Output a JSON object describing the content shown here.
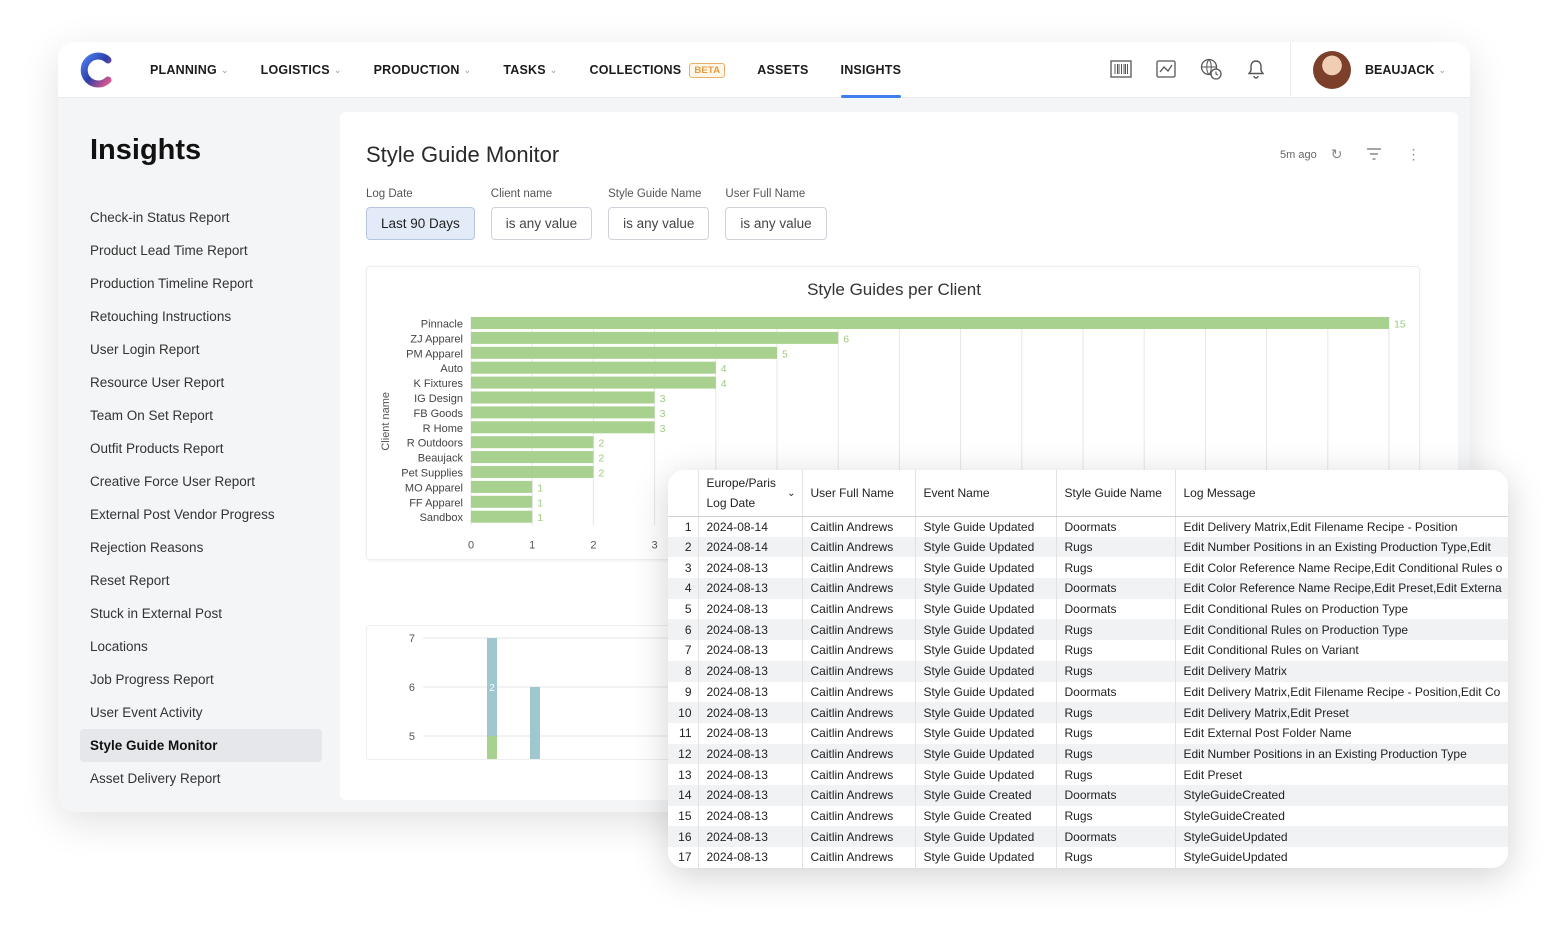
{
  "nav": {
    "items": [
      {
        "label": "PLANNING",
        "chevron": true
      },
      {
        "label": "LOGISTICS",
        "chevron": true
      },
      {
        "label": "PRODUCTION",
        "chevron": true
      },
      {
        "label": "TASKS",
        "chevron": true
      },
      {
        "label": "COLLECTIONS",
        "badge": "BETA"
      },
      {
        "label": "ASSETS"
      },
      {
        "label": "INSIGHTS",
        "active": true
      }
    ],
    "icons": [
      "barcode-icon",
      "chart-window-icon",
      "globe-clock-icon",
      "bell-icon"
    ],
    "user": "BEAUJACK",
    "accent": "#3f7df0"
  },
  "sidebar": {
    "title": "Insights",
    "items": [
      "Check-in Status Report",
      "Product Lead Time Report",
      "Production Timeline Report",
      "Retouching Instructions",
      "User Login Report",
      "Resource User Report",
      "Team On Set Report",
      "Outfit Products Report",
      "Creative Force User Report",
      "External Post Vendor Progress",
      "Rejection Reasons",
      "Reset Report",
      "Stuck in External Post",
      "Locations",
      "Job Progress Report",
      "User Event Activity",
      "Style Guide Monitor",
      "Asset Delivery Report"
    ],
    "active": "Style Guide Monitor"
  },
  "panel": {
    "title": "Style Guide Monitor",
    "updated": "5m ago",
    "filters": [
      {
        "label": "Log Date",
        "value": "Last 90 Days",
        "selected": true
      },
      {
        "label": "Client name",
        "value": "is any value"
      },
      {
        "label": "Style Guide Name",
        "value": "is any value"
      },
      {
        "label": "User Full Name",
        "value": "is any value"
      }
    ]
  },
  "chart_data": [
    {
      "type": "bar",
      "orientation": "horizontal",
      "title": "Style Guides per Client",
      "ylabel": "Client name",
      "categories": [
        "Pinnacle",
        "ZJ Apparel",
        "PM Apparel",
        "Auto",
        "K Fixtures",
        "IG Design",
        "FB Goods",
        "R Home",
        "R Outdoors",
        "Beaujack",
        "Pet Supplies",
        "MO Apparel",
        "FF Apparel",
        "Sandbox"
      ],
      "values": [
        15,
        6,
        5,
        4,
        4,
        3,
        3,
        3,
        2,
        2,
        2,
        1,
        1,
        1
      ],
      "xlim": [
        0,
        15
      ],
      "xticks_visible": [
        0,
        1,
        2,
        3
      ],
      "grid": true,
      "color": "#a8d18f",
      "label_color": "#9ccb80"
    },
    {
      "type": "bar",
      "stacked": true,
      "yticks": [
        7,
        6,
        5
      ],
      "bars": [
        {
          "segments": [
            {
              "color": "#9ec7cf",
              "top": 7
            },
            {
              "color": "#a8d18f",
              "top": 5
            }
          ],
          "label": "2"
        },
        {
          "segments": [
            {
              "color": "#9ec7cf",
              "top": 6
            }
          ]
        }
      ]
    }
  ],
  "table": {
    "timezone": "Europe/Paris",
    "columns": [
      "Log Date",
      "User Full Name",
      "Event Name",
      "Style Guide Name",
      "Log Message"
    ],
    "rows": [
      [
        "1",
        "2024-08-14",
        "Caitlin Andrews",
        "Style Guide Updated",
        "Doormats",
        "Edit Delivery Matrix,Edit Filename Recipe - Position"
      ],
      [
        "2",
        "2024-08-14",
        "Caitlin Andrews",
        "Style Guide Updated",
        "Rugs",
        "Edit Number Positions in an Existing Production Type,Edit"
      ],
      [
        "3",
        "2024-08-13",
        "Caitlin Andrews",
        "Style Guide Updated",
        "Rugs",
        "Edit Color Reference Name Recipe,Edit Conditional Rules o"
      ],
      [
        "4",
        "2024-08-13",
        "Caitlin Andrews",
        "Style Guide Updated",
        "Doormats",
        "Edit Color Reference Name Recipe,Edit Preset,Edit Externa"
      ],
      [
        "5",
        "2024-08-13",
        "Caitlin Andrews",
        "Style Guide Updated",
        "Doormats",
        "Edit Conditional Rules on Production Type"
      ],
      [
        "6",
        "2024-08-13",
        "Caitlin Andrews",
        "Style Guide Updated",
        "Rugs",
        "Edit Conditional Rules on Production Type"
      ],
      [
        "7",
        "2024-08-13",
        "Caitlin Andrews",
        "Style Guide Updated",
        "Rugs",
        "Edit Conditional Rules on Variant"
      ],
      [
        "8",
        "2024-08-13",
        "Caitlin Andrews",
        "Style Guide Updated",
        "Rugs",
        "Edit Delivery Matrix"
      ],
      [
        "9",
        "2024-08-13",
        "Caitlin Andrews",
        "Style Guide Updated",
        "Doormats",
        "Edit Delivery Matrix,Edit Filename Recipe - Position,Edit Co"
      ],
      [
        "10",
        "2024-08-13",
        "Caitlin Andrews",
        "Style Guide Updated",
        "Rugs",
        "Edit Delivery Matrix,Edit Preset"
      ],
      [
        "11",
        "2024-08-13",
        "Caitlin Andrews",
        "Style Guide Updated",
        "Rugs",
        "Edit External Post Folder Name"
      ],
      [
        "12",
        "2024-08-13",
        "Caitlin Andrews",
        "Style Guide Updated",
        "Rugs",
        "Edit Number Positions in an Existing Production Type"
      ],
      [
        "13",
        "2024-08-13",
        "Caitlin Andrews",
        "Style Guide Updated",
        "Rugs",
        "Edit Preset"
      ],
      [
        "14",
        "2024-08-13",
        "Caitlin Andrews",
        "Style Guide Created",
        "Doormats",
        "StyleGuideCreated"
      ],
      [
        "15",
        "2024-08-13",
        "Caitlin Andrews",
        "Style Guide Created",
        "Rugs",
        "StyleGuideCreated"
      ],
      [
        "16",
        "2024-08-13",
        "Caitlin Andrews",
        "Style Guide Updated",
        "Doormats",
        "StyleGuideUpdated"
      ],
      [
        "17",
        "2024-08-13",
        "Caitlin Andrews",
        "Style Guide Updated",
        "Rugs",
        "StyleGuideUpdated"
      ]
    ]
  }
}
